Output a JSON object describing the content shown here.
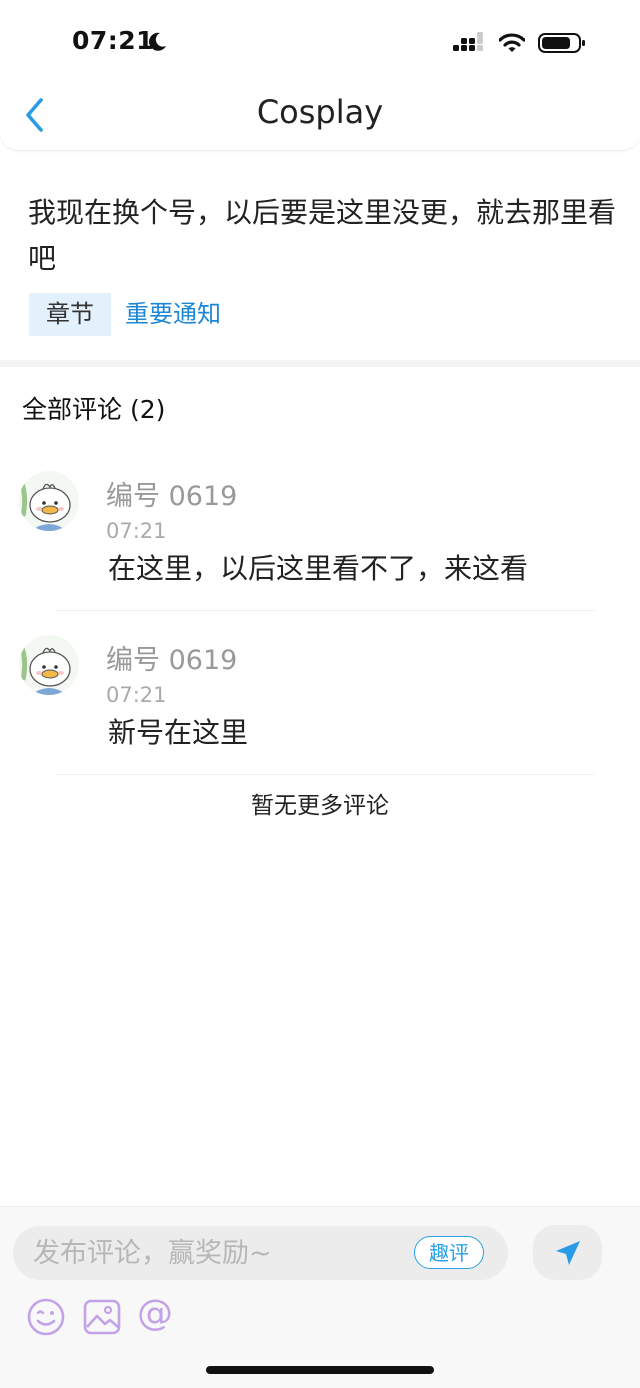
{
  "status_bar": {
    "time": "07:21"
  },
  "nav": {
    "title": "Cosplay"
  },
  "post": {
    "content": "我现在换个号，以后要是这里没更，就去那里看吧",
    "tags": [
      "章节",
      "重要通知"
    ]
  },
  "comments": {
    "header": "全部评论 (2)",
    "items": [
      {
        "author": "编号 0619",
        "time": "07:21",
        "text": "在这里，以后这里看不了，来这看"
      },
      {
        "author": "编号 0619",
        "time": "07:21",
        "text": "新号在这里"
      }
    ],
    "end_text": "暂无更多评论"
  },
  "bottom_bar": {
    "input_placeholder": "发布评论，赢奖励~",
    "quping_label": "趣评",
    "at_symbol": "@"
  },
  "colors": {
    "accent": "#1d87d6",
    "tag_bg": "#e3f1fc",
    "toolbar_icon": "#c3a3e8"
  },
  "icons": [
    "moon-icon",
    "signal-icon",
    "wifi-icon",
    "battery-icon",
    "back-chevron-icon",
    "send-icon",
    "emoji-icon",
    "image-icon"
  ]
}
